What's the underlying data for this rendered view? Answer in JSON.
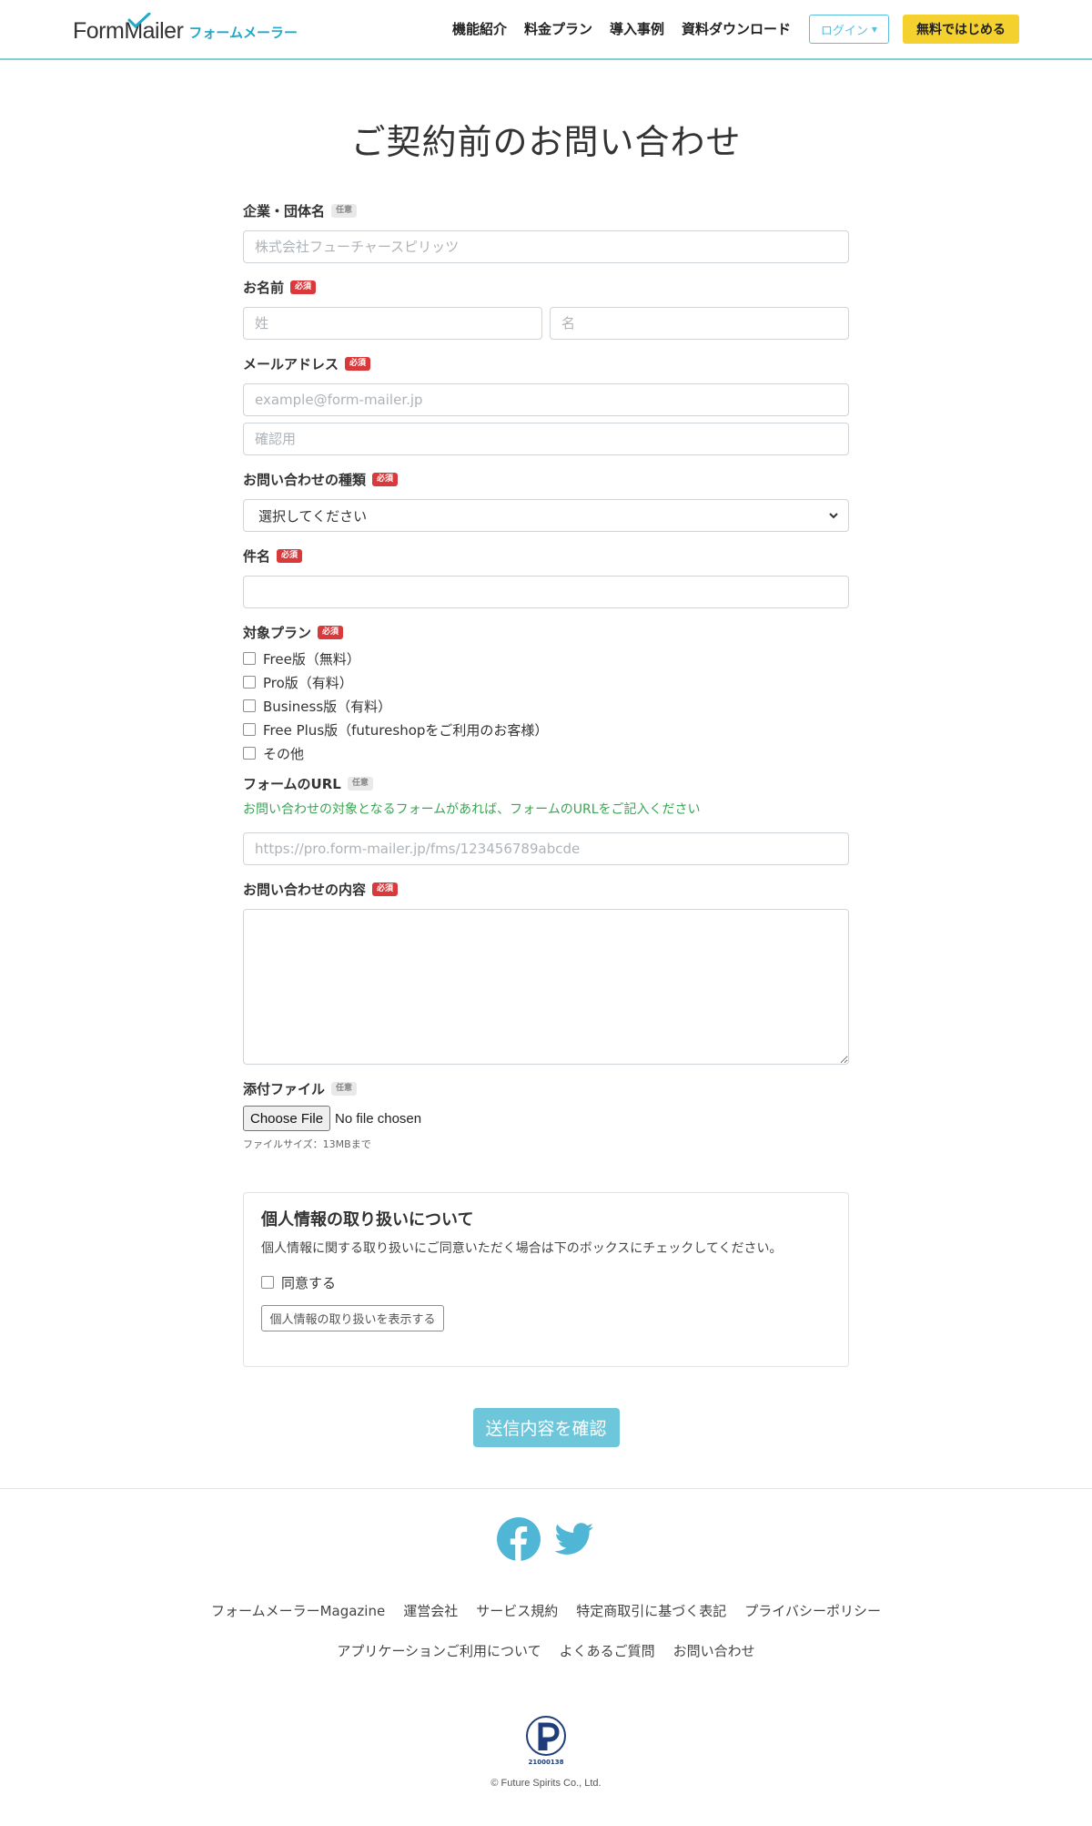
{
  "header": {
    "logo_en": "FormMailer",
    "logo_ja": "フォームメーラー",
    "nav": [
      "機能紹介",
      "料金プラン",
      "導入事例",
      "資料ダウンロード"
    ],
    "login": "ログイン",
    "start": "無料ではじめる"
  },
  "page_title": "ご契約前のお問い合わせ",
  "badges": {
    "required": "必須",
    "optional": "任意"
  },
  "form": {
    "company": {
      "label": "企業・団体名",
      "placeholder": "株式会社フューチャースピリッツ"
    },
    "name": {
      "label": "お名前",
      "last_placeholder": "姓",
      "first_placeholder": "名"
    },
    "email": {
      "label": "メールアドレス",
      "placeholder": "example@form-mailer.jp",
      "confirm_placeholder": "確認用"
    },
    "inquiry_type": {
      "label": "お問い合わせの種類",
      "selected": "選択してください"
    },
    "subject": {
      "label": "件名",
      "value": ""
    },
    "plan": {
      "label": "対象プラン",
      "options": [
        "Free版（無料）",
        "Pro版（有料）",
        "Business版（有料）",
        "Free Plus版（futureshopをご利用のお客様）",
        "その他"
      ]
    },
    "form_url": {
      "label": "フォームのURL",
      "help": "お問い合わせの対象となるフォームがあれば、フォームのURLをご記入ください",
      "placeholder": "https://pro.form-mailer.jp/fms/123456789abcde"
    },
    "content": {
      "label": "お問い合わせの内容",
      "value": ""
    },
    "attachment": {
      "label": "添付ファイル",
      "button": "Choose File",
      "status": "No file chosen",
      "note": "ファイルサイズ：13MBまで"
    }
  },
  "privacy": {
    "title": "個人情報の取り扱いについて",
    "text": "個人情報に関する取り扱いにご同意いただく場合は下のボックスにチェックしてください。",
    "agree": "同意する",
    "show_button": "個人情報の取り扱いを表示する"
  },
  "submit": "送信内容を確認",
  "footer": {
    "links_row1": [
      "フォームメーラーMagazine",
      "運営会社",
      "サービス規約",
      "特定商取引に基づく表記",
      "プライバシーポリシー"
    ],
    "links_row2": [
      "アプリケーションご利用について",
      "よくあるご質問",
      "お問い合わせ"
    ],
    "pmark_number": "21000138",
    "copyright": "© Future Spirits Co., Ltd."
  },
  "colors": {
    "accent": "#5bc0de",
    "start_button": "#f5d12f",
    "required_badge": "#d9393b",
    "help_green": "#3aa553",
    "social_icon": "#4fb6d6"
  },
  "icons": [
    "check-icon",
    "caret-down-icon",
    "chevron-down-icon",
    "facebook-icon",
    "twitter-icon",
    "privacy-mark-icon"
  ]
}
